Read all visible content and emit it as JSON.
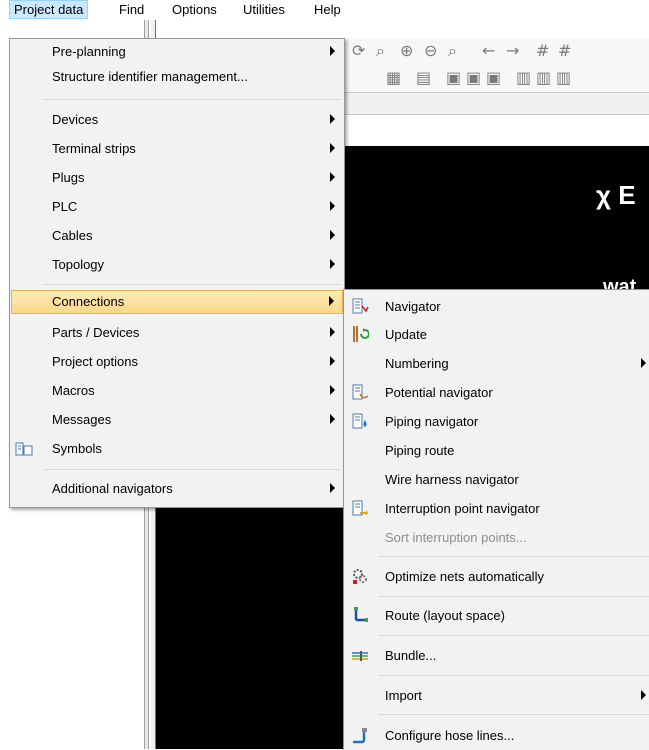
{
  "menubar": {
    "items": [
      {
        "label": "Project data"
      },
      {
        "label": "Find"
      },
      {
        "label": "Options"
      },
      {
        "label": "Utilities"
      },
      {
        "label": "Help"
      }
    ]
  },
  "background": {
    "logo": "χ E",
    "logo_text": "wat"
  },
  "project_data_menu": {
    "items": [
      {
        "label": "Pre-planning"
      },
      {
        "label": "Structure identifier management..."
      },
      {
        "label": "Devices"
      },
      {
        "label": "Terminal strips"
      },
      {
        "label": "Plugs"
      },
      {
        "label": "PLC"
      },
      {
        "label": "Cables"
      },
      {
        "label": "Topology"
      },
      {
        "label": "Connections"
      },
      {
        "label": "Parts / Devices"
      },
      {
        "label": "Project options"
      },
      {
        "label": "Macros"
      },
      {
        "label": "Messages"
      },
      {
        "label": "Symbols"
      },
      {
        "label": "Additional navigators"
      }
    ]
  },
  "connections_submenu": {
    "items": [
      {
        "label": "Navigator"
      },
      {
        "label": "Update"
      },
      {
        "label": "Numbering"
      },
      {
        "label": "Potential navigator"
      },
      {
        "label": "Piping navigator"
      },
      {
        "label": "Piping route"
      },
      {
        "label": "Wire harness navigator"
      },
      {
        "label": "Interruption point navigator"
      },
      {
        "label": "Sort interruption points..."
      },
      {
        "label": "Optimize nets automatically"
      },
      {
        "label": "Route (layout space)"
      },
      {
        "label": "Bundle..."
      },
      {
        "label": "Import"
      },
      {
        "label": "Configure hose lines..."
      }
    ]
  },
  "colors": {
    "highlight": "#fcd88a",
    "menu_bg": "#f2f2f2",
    "active_menubar": "#cce8ff",
    "disabled_text": "#8d8d8d"
  }
}
